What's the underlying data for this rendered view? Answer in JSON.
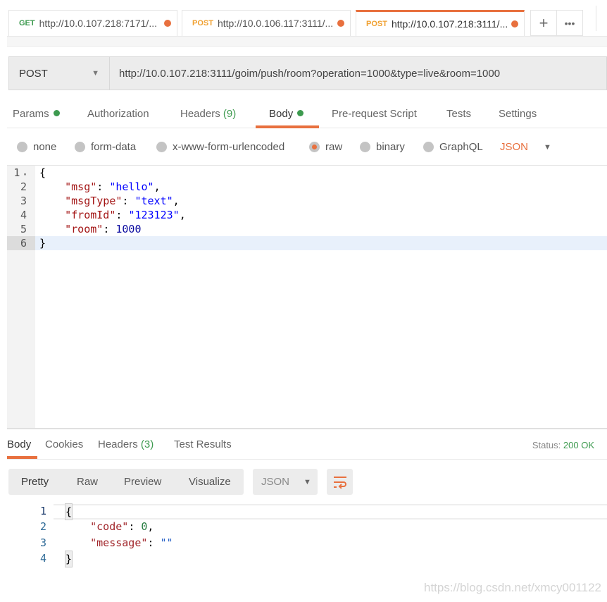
{
  "tabs": [
    {
      "method": "GET",
      "url": "http://10.0.107.218:7171/...",
      "method_color": "#3d9a4f"
    },
    {
      "method": "POST",
      "url": "http://10.0.106.117:3111/...",
      "method_color": "#f0a030"
    },
    {
      "method": "POST",
      "url": "http://10.0.107.218:3111/...",
      "method_color": "#f0a030",
      "active": true
    }
  ],
  "tab_actions": {
    "add": "+",
    "more": "•••"
  },
  "request": {
    "method": "POST",
    "url": "http://10.0.107.218:3111/goim/push/room?operation=1000&type=live&room=1000"
  },
  "request_tabs": {
    "params": "Params",
    "authorization": "Authorization",
    "headers": "Headers",
    "headers_count": "(9)",
    "body": "Body",
    "prerequest": "Pre-request Script",
    "tests": "Tests",
    "settings": "Settings"
  },
  "body_options": {
    "none": "none",
    "form_data": "form-data",
    "urlencoded": "x-www-form-urlencoded",
    "raw": "raw",
    "binary": "binary",
    "graphql": "GraphQL",
    "format": "JSON",
    "selected": "raw"
  },
  "request_body": {
    "l1": "{",
    "l2k": "\"msg\"",
    "l2v": "\"hello\"",
    "l3k": "\"msgType\"",
    "l3v": "\"text\"",
    "l4k": "\"fromId\"",
    "l4v": "\"123123\"",
    "l5k": "\"room\"",
    "l5v": "1000",
    "l6": "}"
  },
  "response_tabs": {
    "body": "Body",
    "cookies": "Cookies",
    "headers": "Headers",
    "headers_count": "(3)",
    "test_results": "Test Results",
    "status_label": "Status:",
    "status_value": "200 OK"
  },
  "response_toolbar": {
    "pretty": "Pretty",
    "raw": "Raw",
    "preview": "Preview",
    "visualize": "Visualize",
    "format": "JSON"
  },
  "response_body": {
    "l1": "{",
    "l2k": "\"code\"",
    "l2v": "0",
    "l3k": "\"message\"",
    "l3v": "\"\"",
    "l4": "}"
  },
  "watermark": "https://blog.csdn.net/xmcy001122",
  "colors": {
    "accent": "#e8703e",
    "green": "#3d9a4f"
  }
}
